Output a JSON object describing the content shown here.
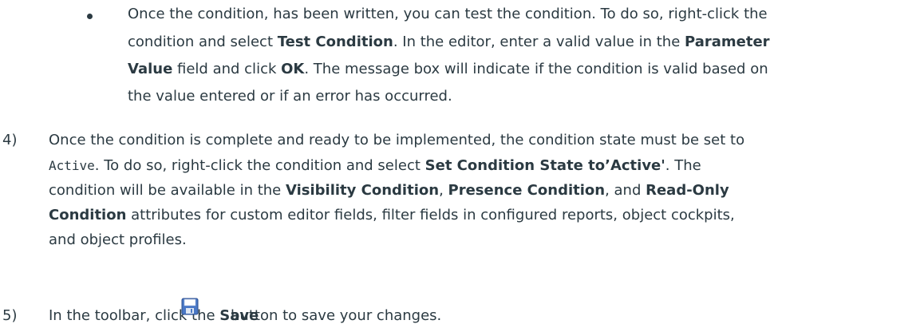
{
  "bullet_item": {
    "lines": [
      [
        "Once the condition, has been written, you can test the condition. To do so, right-click the"
      ],
      [
        "condition and select ",
        "Test Condition",
        ". In the editor, enter a valid value in the ",
        "Parameter"
      ],
      [
        "Value",
        " field and click ",
        "OK",
        ". The message box will indicate if the condition is valid based on"
      ],
      [
        "the value entered or if an error has occurred."
      ]
    ]
  },
  "step4": {
    "number": "4)",
    "l1": "Once the condition is complete and ready to be implemented, the condition state must be set to",
    "l2_code": "Active",
    "l2_a": ". To do so, right-click the condition and select ",
    "l2_bold": "Set Condition State to’Active'",
    "l2_b": ". The",
    "l3_a": "condition will be available in the ",
    "l3_bold1": "Visibility Condition",
    "l3_sep": ", ",
    "l3_bold2": "Presence Condition",
    "l3_b": ", and ",
    "l3_bold3": "Read-Only",
    "l4_bold": "Condition",
    "l4_a": " attributes for custom editor fields, filter fields in configured reports, object cockpits,",
    "l5": "and object profiles."
  },
  "step5": {
    "number": "5)",
    "a": "In the toolbar, click the ",
    "bold": "Save",
    "b": "button to save your changes.",
    "icon": "save-icon"
  },
  "colors": {
    "text": "#2b3a42",
    "icon_blue": "#4a78c6"
  }
}
